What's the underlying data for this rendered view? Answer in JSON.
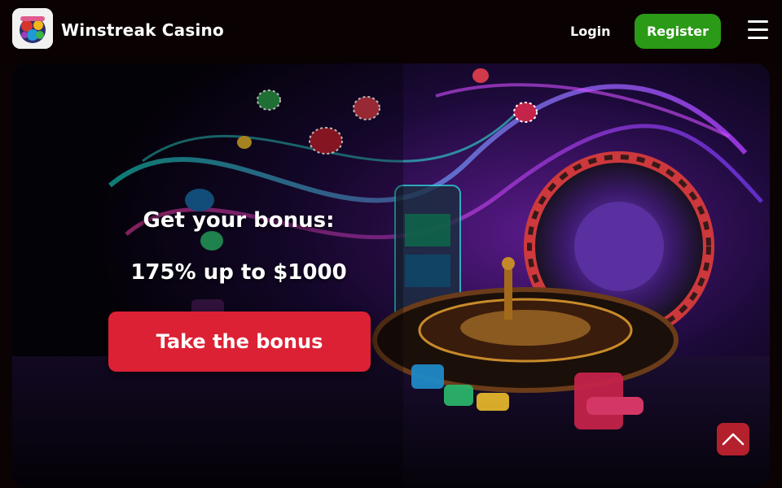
{
  "header": {
    "brand": "Winstreak Casino",
    "login_label": "Login",
    "register_label": "Register"
  },
  "hero": {
    "bonus_title": "Get your bonus:",
    "bonus_amount": "175% up to $1000",
    "cta_label": "Take the bonus"
  },
  "colors": {
    "register": "#2b9a16",
    "cta": "#dc2134",
    "scroll_top": "#b4202c"
  },
  "icons": {
    "logo": "casino-logo-icon",
    "menu": "hamburger-menu-icon",
    "scroll_top": "chevron-up-icon"
  }
}
